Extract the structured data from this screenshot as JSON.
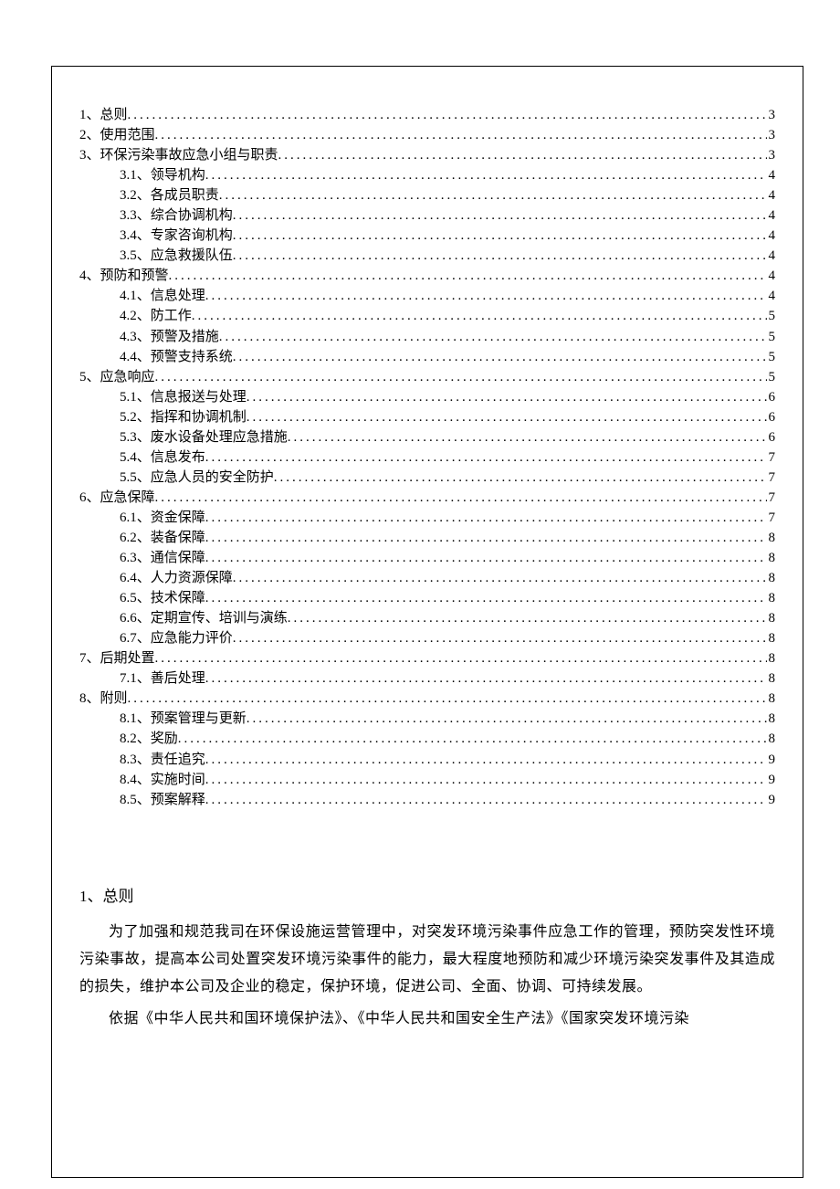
{
  "toc": [
    {
      "level": 1,
      "label": "1、总则",
      "page": "3"
    },
    {
      "level": 1,
      "label": "2、使用范围",
      "page": "3"
    },
    {
      "level": 1,
      "label": "3、环保污染事故应急小组与职责",
      "page": "3"
    },
    {
      "level": 2,
      "label": "3.1、领导机构",
      "page": "4"
    },
    {
      "level": 2,
      "label": "3.2、各成员职责",
      "page": "4"
    },
    {
      "level": 2,
      "label": "3.3、综合协调机构",
      "page": "4"
    },
    {
      "level": 2,
      "label": "3.4、专家咨询机构",
      "page": "4"
    },
    {
      "level": 2,
      "label": "3.5、应急救援队伍",
      "page": "4"
    },
    {
      "level": 1,
      "label": "4、预防和预警",
      "page": "4"
    },
    {
      "level": 2,
      "label": "4.1、信息处理",
      "page": "4"
    },
    {
      "level": 2,
      "label": "4.2、防工作",
      "page": "5"
    },
    {
      "level": 2,
      "label": "4.3、预警及措施",
      "page": "5"
    },
    {
      "level": 2,
      "label": "4.4、预警支持系统",
      "page": "5"
    },
    {
      "level": 1,
      "label": "5、应急响应",
      "page": "5"
    },
    {
      "level": 2,
      "label": "5.1、信息报送与处理",
      "page": "6"
    },
    {
      "level": 2,
      "label": "5.2、指挥和协调机制",
      "page": "6"
    },
    {
      "level": 2,
      "label": "5.3、废水设备处理应急措施",
      "page": "6"
    },
    {
      "level": 2,
      "label": "5.4、信息发布",
      "page": "7"
    },
    {
      "level": 2,
      "label": "5.5、应急人员的安全防护",
      "page": "7"
    },
    {
      "level": 1,
      "label": "6、应急保障",
      "page": "7"
    },
    {
      "level": 2,
      "label": "6.1、资金保障",
      "page": "7"
    },
    {
      "level": 2,
      "label": "6.2、装备保障",
      "page": "8"
    },
    {
      "level": 2,
      "label": "6.3、通信保障",
      "page": "8"
    },
    {
      "level": 2,
      "label": "6.4、人力资源保障",
      "page": "8"
    },
    {
      "level": 2,
      "label": "6.5、技术保障",
      "page": "8"
    },
    {
      "level": 2,
      "label": "6.6、定期宣传、培训与演练",
      "page": "8"
    },
    {
      "level": 2,
      "label": "6.7、应急能力评价",
      "page": "8"
    },
    {
      "level": 1,
      "label": "7、后期处置",
      "page": "8"
    },
    {
      "level": 2,
      "label": "7.1、善后处理",
      "page": "8"
    },
    {
      "level": 1,
      "label": "8、附则",
      "page": "8"
    },
    {
      "level": 2,
      "label": "8.1、预案管理与更新",
      "page": "8"
    },
    {
      "level": 2,
      "label": "8.2、奖励",
      "page": "8"
    },
    {
      "level": 2,
      "label": "8.3、责任追究",
      "page": "9"
    },
    {
      "level": 2,
      "label": "8.4、实施时间",
      "page": "9"
    },
    {
      "level": 2,
      "label": "8.5、预案解释",
      "page": "9"
    }
  ],
  "body": {
    "heading": "1、总则",
    "para1": "为了加强和规范我司在环保设施运营管理中，对突发环境污染事件应急工作的管理，预防突发性环境污染事故，提高本公司处置突发环境污染事件的能力，最大程度地预防和减少环境污染突发事件及其造成的损失，维护本公司及企业的稳定，保护环境，促进公司、全面、协调、可持续发展。",
    "para2": "依据《中华人民共和国环境保护法》、《中华人民共和国安全生产法》《国家突发环境污染"
  }
}
